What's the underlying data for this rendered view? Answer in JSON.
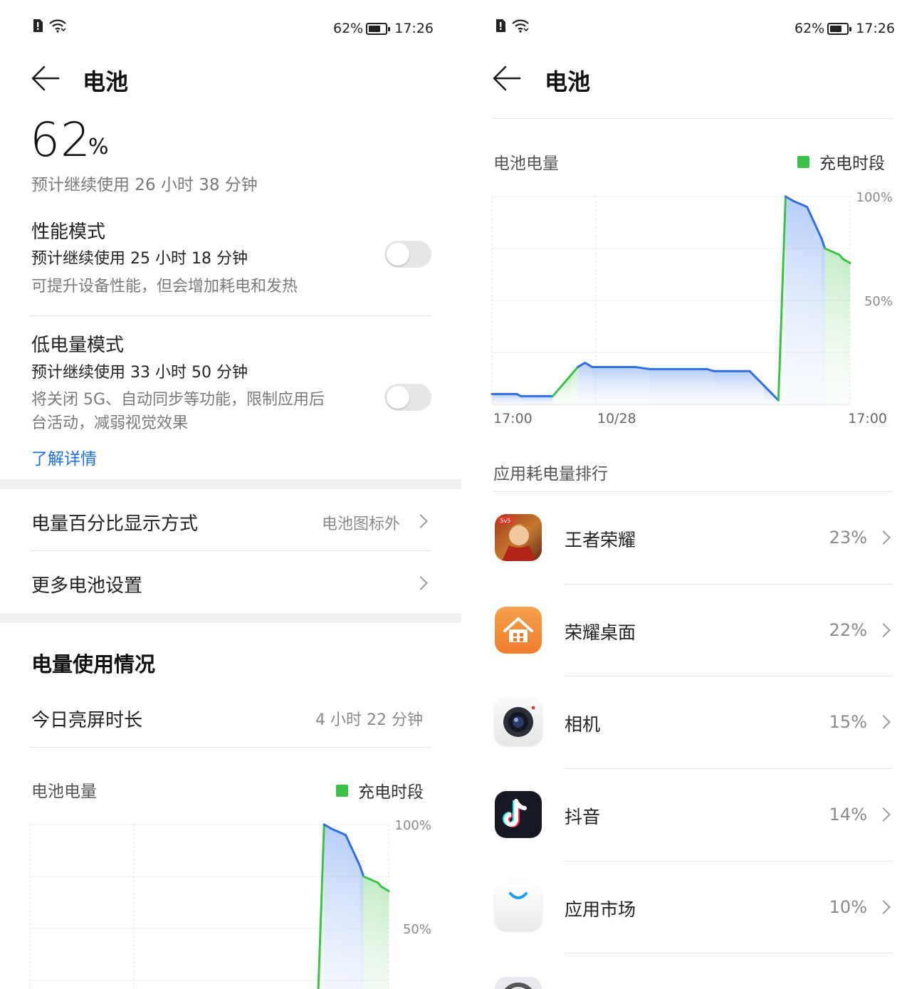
{
  "status_bar": {
    "battery_pct": "62%",
    "time": "17:26",
    "battery_level": 0.62
  },
  "page_title": "电池",
  "battery": {
    "percent": "62",
    "percent_sign": "%",
    "estimate": "预计继续使用 26 小时 38 分钟"
  },
  "performance_mode": {
    "title": "性能模式",
    "estimate": "预计继续使用 25 小时 18 分钟",
    "description": "可提升设备性能，但会增加耗电和发热",
    "enabled": false
  },
  "low_power_mode": {
    "title": "低电量模式",
    "estimate": "预计继续使用 33 小时 50 分钟",
    "description_line1": "将关闭 5G、自动同步等功能，限制应用后",
    "description_line2": "台活动，减弱视觉效果",
    "enabled": false,
    "learn_more": "了解详情"
  },
  "settings": {
    "percent_display": {
      "label": "电量百分比显示方式",
      "value": "电池图标外"
    },
    "more_settings": {
      "label": "更多电池设置"
    }
  },
  "usage": {
    "heading": "电量使用情况",
    "screen_time_label": "今日亮屏时长",
    "screen_time_value": "4 小时 22 分钟"
  },
  "battery_chart": {
    "heading": "电池电量",
    "legend_charging": "充电时段",
    "colors": {
      "line": "#2f6fe0",
      "charging": "#3cc24a"
    }
  },
  "chart_data": {
    "type": "area",
    "title": "电池电量",
    "y_ticks": [
      "100%",
      "50%"
    ],
    "x_ticks": [
      "17:00",
      "10/28",
      "17:00"
    ],
    "ylim": [
      0,
      100
    ],
    "legend": [
      "充电时段"
    ],
    "series": [
      {
        "x": [
          0,
          0.07,
          0.08,
          0.17,
          0.22,
          0.24,
          0.26,
          0.28,
          0.4,
          0.44,
          0.6,
          0.62,
          0.72,
          0.76,
          0.76,
          0.8,
          0.82,
          0.84,
          0.88,
          0.92,
          0.93,
          0.97,
          0.98,
          1.0
        ],
        "y": [
          5,
          5,
          4,
          4,
          14,
          18,
          20,
          18,
          18,
          17,
          17,
          16,
          16,
          9,
          9,
          2,
          100,
          98,
          95,
          80,
          75,
          72,
          70,
          68
        ],
        "charging": [
          false,
          false,
          false,
          false,
          true,
          true,
          false,
          false,
          false,
          false,
          false,
          false,
          false,
          false,
          false,
          false,
          true,
          false,
          false,
          false,
          false,
          true,
          true,
          true
        ]
      }
    ]
  },
  "app_ranking": {
    "heading": "应用耗电量排行",
    "apps": [
      {
        "name": "王者荣耀",
        "percent": "23%",
        "icon": "game-icon"
      },
      {
        "name": "荣耀桌面",
        "percent": "22%",
        "icon": "home-launcher-icon"
      },
      {
        "name": "相机",
        "percent": "15%",
        "icon": "camera-icon"
      },
      {
        "name": "抖音",
        "percent": "14%",
        "icon": "tiktok-icon"
      },
      {
        "name": "应用市场",
        "percent": "10%",
        "icon": "app-market-icon"
      }
    ]
  }
}
